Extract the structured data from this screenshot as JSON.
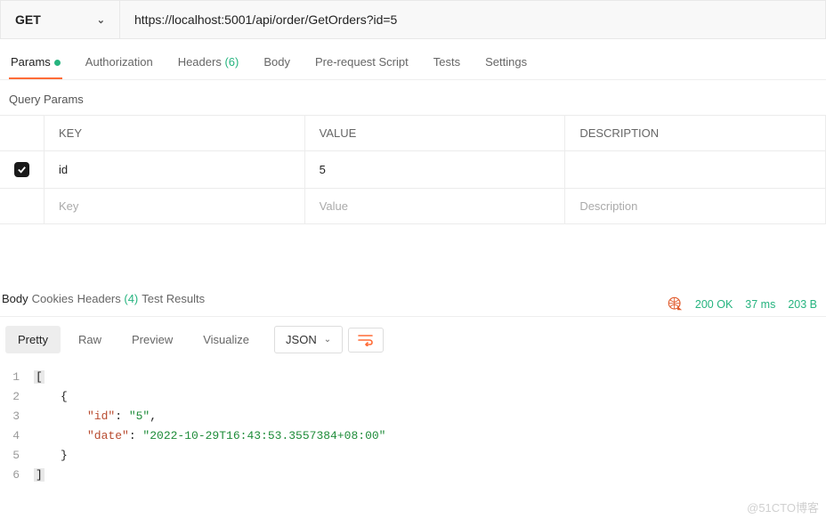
{
  "request": {
    "method": "GET",
    "url": "https://localhost:5001/api/order/GetOrders?id=5"
  },
  "tabs": {
    "params": "Params",
    "auth": "Authorization",
    "headers": "Headers",
    "headers_count": "(6)",
    "body": "Body",
    "prerequest": "Pre-request Script",
    "tests": "Tests",
    "settings": "Settings"
  },
  "params_section": {
    "title": "Query Params",
    "headers": {
      "key": "KEY",
      "value": "VALUE",
      "desc": "DESCRIPTION"
    },
    "rows": [
      {
        "key": "id",
        "value": "5",
        "desc": ""
      }
    ],
    "placeholder": {
      "key": "Key",
      "value": "Value",
      "desc": "Description"
    }
  },
  "response": {
    "tabs": {
      "body": "Body",
      "cookies": "Cookies",
      "headers": "Headers",
      "headers_count": "(4)",
      "tests": "Test Results"
    },
    "status_code": "200",
    "status_text": "OK",
    "time": "37 ms",
    "size": "203 B",
    "views": {
      "pretty": "Pretty",
      "raw": "Raw",
      "preview": "Preview",
      "visualize": "Visualize"
    },
    "format": "JSON",
    "json": {
      "l1": "[",
      "l2": "{",
      "l3_k": "\"id\"",
      "l3_c": ": ",
      "l3_v": "\"5\"",
      "l3_e": ",",
      "l4_k": "\"date\"",
      "l4_c": ": ",
      "l4_v": "\"2022-10-29T16:43:53.3557384+08:00\"",
      "l5": "}",
      "l6": "]"
    }
  },
  "watermark": "@51CTO博客"
}
